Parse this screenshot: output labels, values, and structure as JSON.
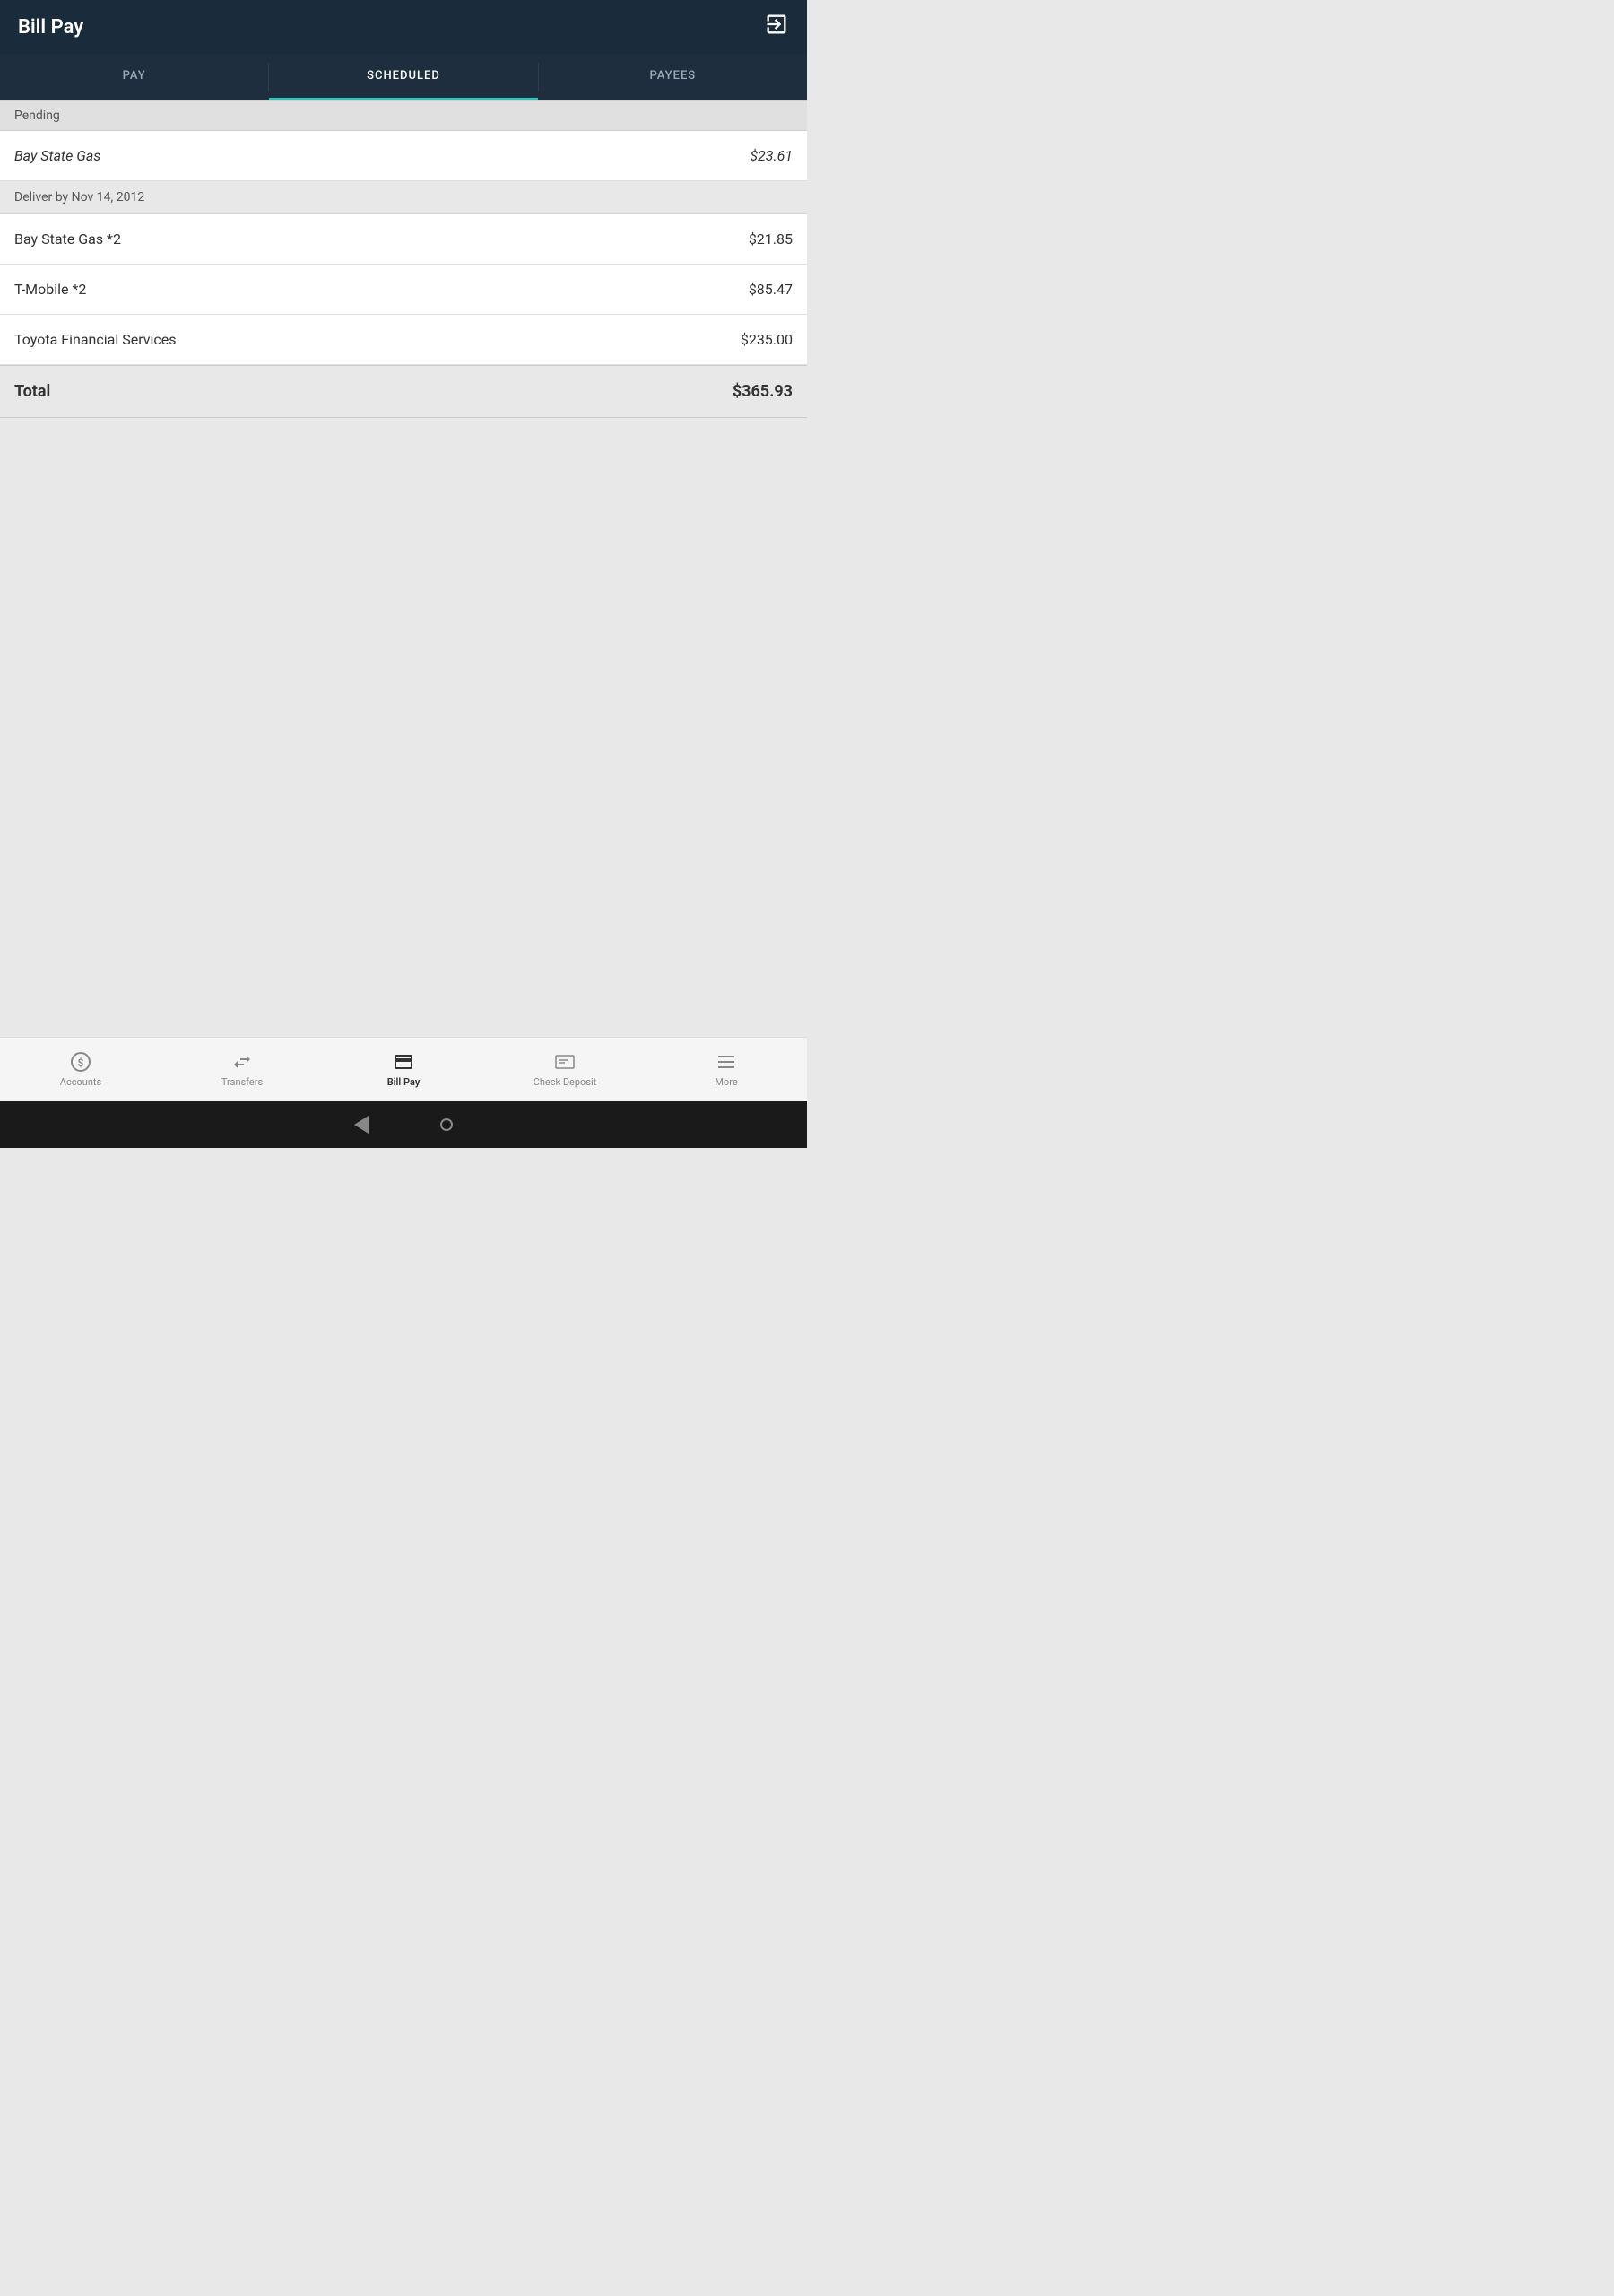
{
  "header": {
    "title": "Bill Pay",
    "icon_label": "logout-icon"
  },
  "tabs": [
    {
      "id": "pay",
      "label": "PAY",
      "active": false
    },
    {
      "id": "scheduled",
      "label": "SCHEDULED",
      "active": true
    },
    {
      "id": "payees",
      "label": "PAYEES",
      "active": false
    }
  ],
  "sections": [
    {
      "id": "pending",
      "header": "Pending",
      "items": [
        {
          "name": "Bay State Gas",
          "amount": "$23.61",
          "italic": true
        }
      ]
    },
    {
      "id": "deliver-by",
      "header": "Deliver by Nov 14, 2012",
      "items": [
        {
          "name": "Bay State Gas *2",
          "amount": "$21.85",
          "italic": false
        },
        {
          "name": "T-Mobile *2",
          "amount": "$85.47",
          "italic": false
        },
        {
          "name": "Toyota Financial Services",
          "amount": "$235.00",
          "italic": false
        }
      ]
    }
  ],
  "total": {
    "label": "Total",
    "amount": "$365.93"
  },
  "bottom_nav": {
    "items": [
      {
        "id": "accounts",
        "label": "Accounts",
        "active": false
      },
      {
        "id": "transfers",
        "label": "Transfers",
        "active": false
      },
      {
        "id": "bill-pay",
        "label": "Bill Pay",
        "active": true
      },
      {
        "id": "check-deposit",
        "label": "Check Deposit",
        "active": false
      },
      {
        "id": "more",
        "label": "More",
        "active": false
      }
    ]
  }
}
